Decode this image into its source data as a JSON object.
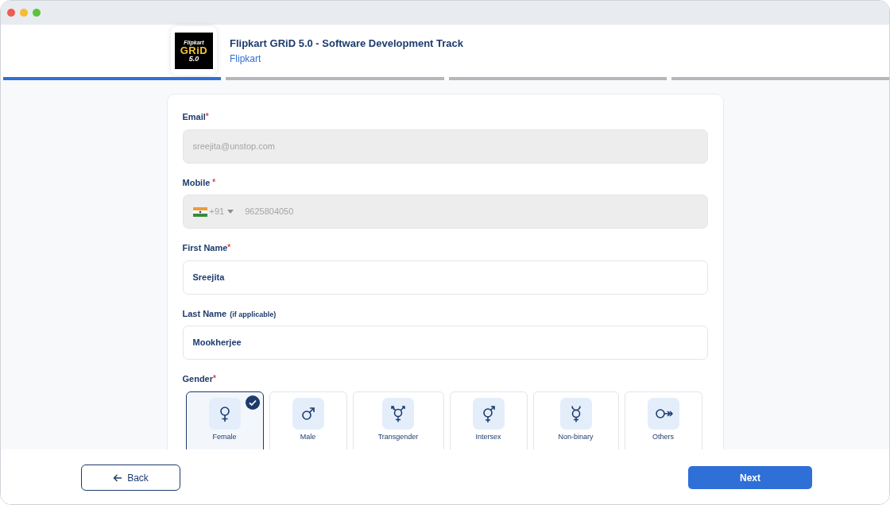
{
  "event": {
    "logo_lines": [
      "Flipkart",
      "GRiD",
      "5.0"
    ],
    "title": "Flipkart GRiD 5.0 - Software Development Track",
    "organizer": "Flipkart"
  },
  "steps": [
    {
      "completed": true
    },
    {
      "completed": false
    },
    {
      "completed": false
    },
    {
      "completed": false
    }
  ],
  "fields": [
    {
      "kind": "text",
      "label": "Email",
      "required_mark": "*",
      "value": "sreejita@unstop.com",
      "disabled": true
    },
    {
      "kind": "phone",
      "label": "Mobile",
      "required_mark": "*",
      "country_code": "+91",
      "value": "9625804050",
      "disabled": true
    },
    {
      "kind": "text",
      "label": "First Name",
      "required_mark": "*",
      "value": "Sreejita",
      "disabled": false
    },
    {
      "kind": "text",
      "label": "Last Name",
      "hint": "(if applicable)",
      "value": "Mookherjee",
      "disabled": false
    }
  ],
  "gender": {
    "label": "Gender",
    "required_mark": "*",
    "options": [
      {
        "kind": "female",
        "label": "Female",
        "selected": true
      },
      {
        "kind": "male",
        "label": "Male",
        "selected": false
      },
      {
        "kind": "transgender",
        "label": "Transgender",
        "selected": false
      },
      {
        "kind": "intersex",
        "label": "Intersex",
        "selected": false
      },
      {
        "kind": "nonbinary",
        "label": "Non-binary",
        "selected": false
      },
      {
        "kind": "others",
        "label": "Others",
        "selected": false
      }
    ]
  },
  "buttons": {
    "back": "Back",
    "next": "Next"
  }
}
